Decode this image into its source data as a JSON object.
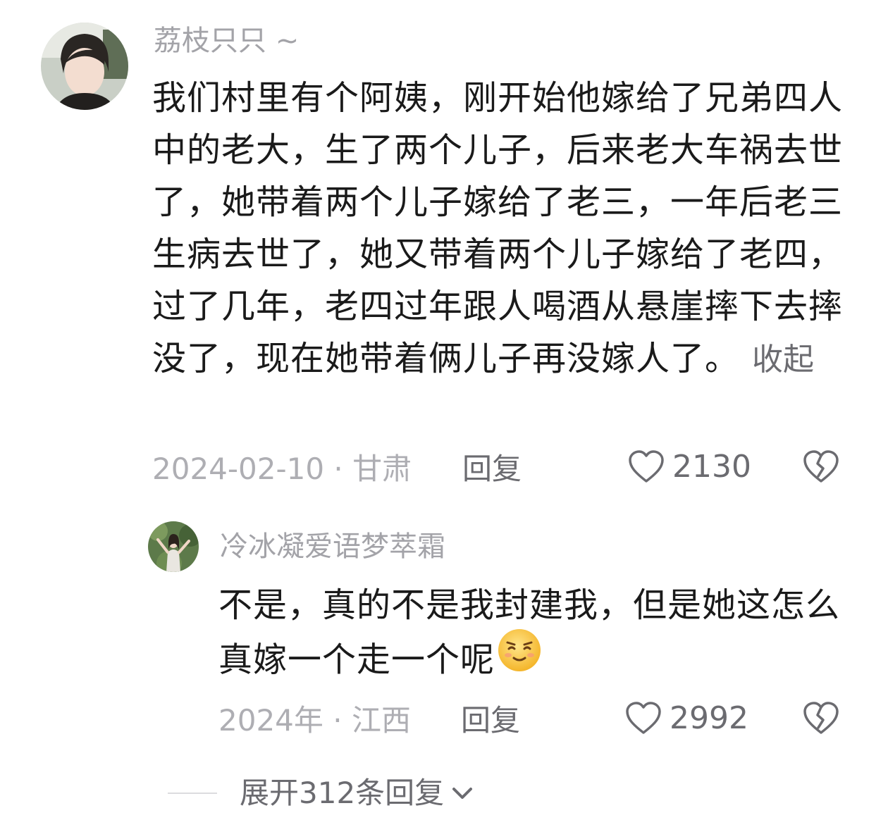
{
  "comment": {
    "username": "荔枝只只 ~",
    "text": "我们村里有个阿姨，刚开始他嫁给了兄弟四人中的老大，生了两个儿子，后来老大车祸去世了，她带着两个儿子嫁给了老三，一年后老三生病去世了，她又带着两个儿子嫁给了老四，过了几年，老四过年跟人喝酒从悬崖摔下去摔没了，现在她带着俩儿子再没嫁人了。",
    "collapse_label": "收起",
    "meta": "2024-02-10 · 甘肃",
    "reply_label": "回复",
    "like_count": "2130",
    "avatar_icon": "user-avatar-photo"
  },
  "reply": {
    "username": "冷冰凝爱语梦萃霜",
    "text": "不是，真的不是我封建我，但是她这怎么真嫁一个走一个呢",
    "emoji_icon": "smirk-emoji-icon",
    "meta": "2024年 · 江西",
    "reply_label": "回复",
    "like_count": "2992",
    "avatar_icon": "user-avatar-photo"
  },
  "expand": {
    "label": "展开312条回复"
  },
  "colors": {
    "text": "#1a1a1a",
    "muted": "#aeaeb3",
    "secondary": "#6b6b70"
  }
}
